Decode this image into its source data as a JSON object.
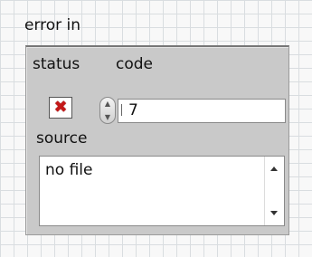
{
  "cluster": {
    "title": "error in"
  },
  "status": {
    "label": "status",
    "value": "error",
    "icon": "red-x-icon",
    "color": "#c41818"
  },
  "code": {
    "label": "code",
    "value": "7"
  },
  "source": {
    "label": "source",
    "value": "no file"
  }
}
